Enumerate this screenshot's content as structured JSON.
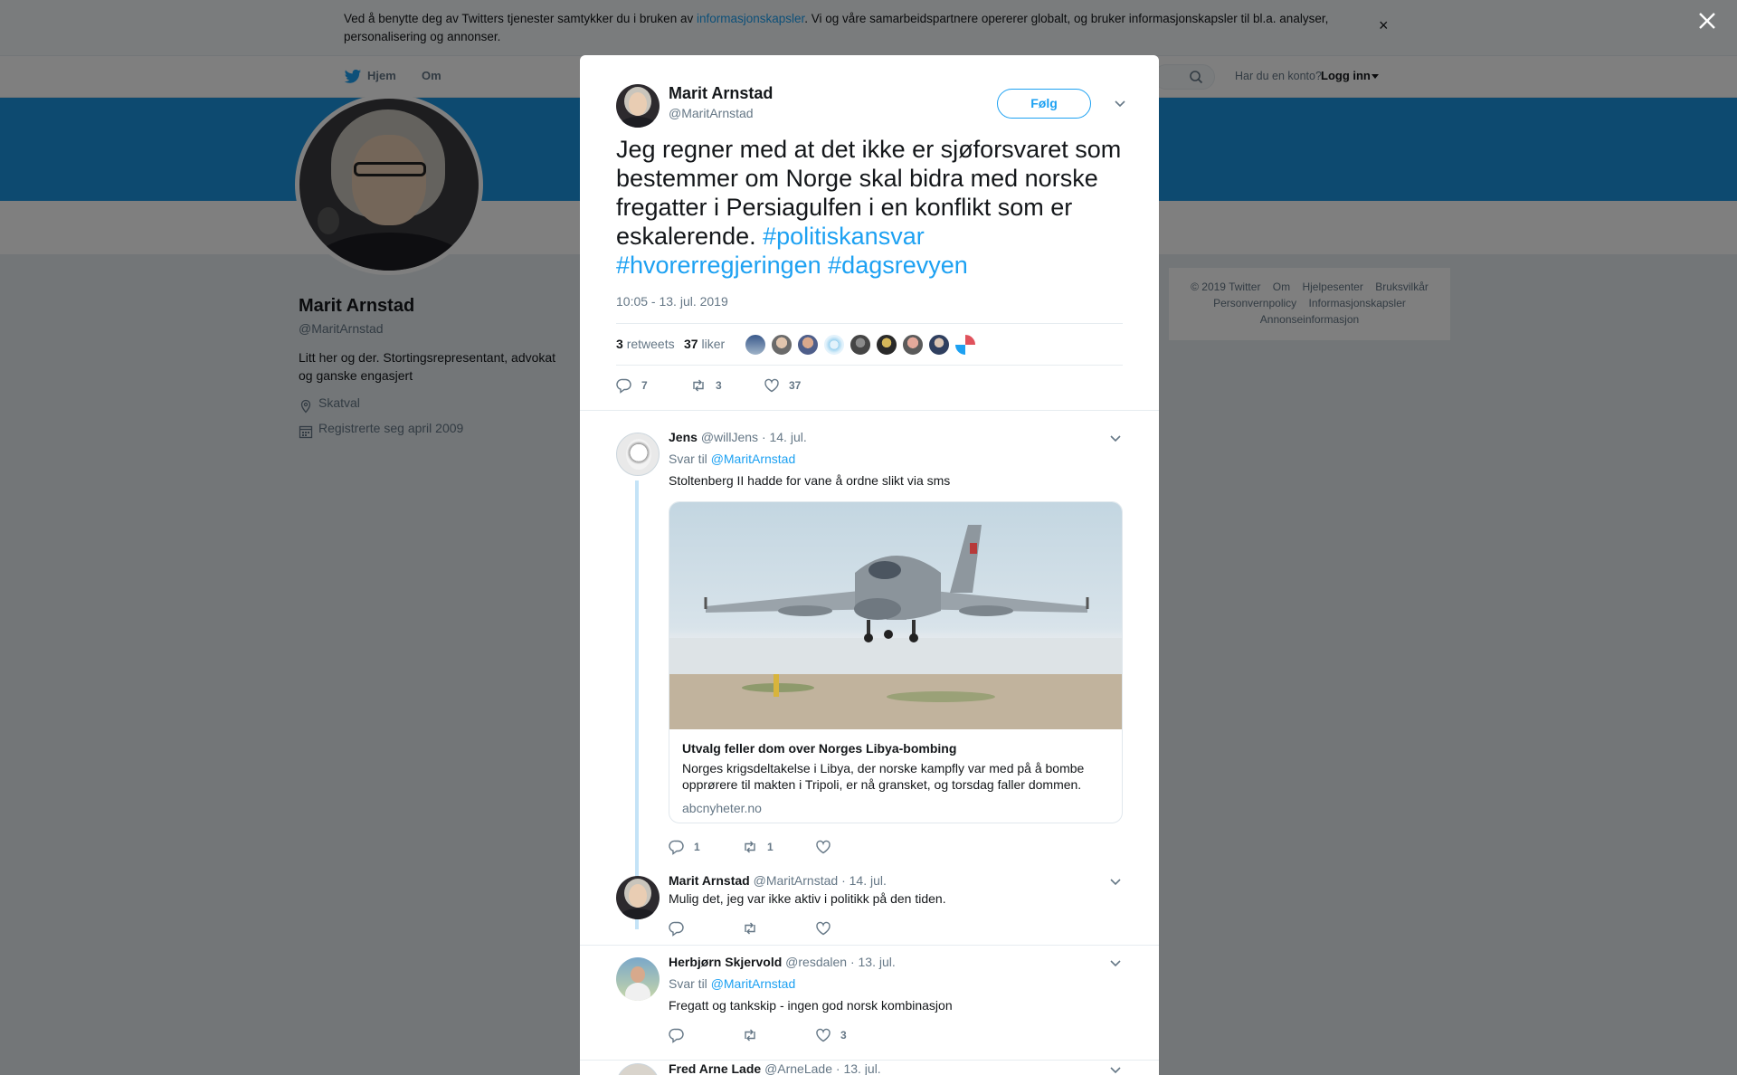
{
  "cookie_bar": {
    "text_before": "Ved å benytte deg av Twitters tjenester samtykker du i bruken av ",
    "link": "informasjonskapsler",
    "text_after": ". Vi og våre samarbeidspartnere opererer globalt, og bruker informasjonskapsler til bl.a. analyser, personalisering og annonser.",
    "close": "×"
  },
  "nav": {
    "home": "Hjem",
    "about": "Om",
    "account_prompt": "Har du en konto?",
    "login": "Logg inn"
  },
  "profile": {
    "name": "Marit Arnstad",
    "handle": "@MaritArnstad",
    "bio": "Litt her og der. Stortingsrepresentant, advokat og ganske engasjert",
    "location": "Skatval",
    "joined": "Registrerte seg april 2009"
  },
  "footer_links": [
    "© 2019 Twitter",
    "Om",
    "Hjelpesenter",
    "Bruksvilkår",
    "Personvernpolicy",
    "Informasjonskapsler",
    "Annonseinformasjon"
  ],
  "tweet": {
    "name": "Marit Arnstad",
    "handle": "@MaritArnstad",
    "follow": "Følg",
    "text": "Jeg regner med at det ikke er sjøforsvaret som bestemmer om Norge skal bidra med norske fregatter i Persiagulfen i en konflikt som er eskalerende.",
    "hashtags": [
      "#politiskansvar",
      "#hvorerregjeringen",
      "#dagsrevyen"
    ],
    "timestamp": "10:05 - 13. jul. 2019",
    "retweets_count": "3",
    "retweets_label": "retweets",
    "likes_count": "37",
    "likes_label": "liker",
    "actions": {
      "replies": "7",
      "retweets": "3",
      "likes": "37"
    }
  },
  "replies": [
    {
      "name": "Jens",
      "handle": "@willJens",
      "date": "· 14. jul.",
      "reply_to_label": "Svar til",
      "reply_to": "@MaritArnstad",
      "text": "Stoltenberg II hadde for vane å ordne slikt via sms",
      "card": {
        "title": "Utvalg feller dom over Norges Libya-bombing",
        "description": "Norges krigsdeltakelse i Libya, der norske kampfly var med på å bombe opprørere til makten i Tripoli, er nå gransket, og torsdag faller dommen.",
        "domain": "abcnyheter.no"
      },
      "actions": {
        "replies": "1",
        "retweets": "1",
        "likes": ""
      }
    },
    {
      "name": "Marit Arnstad",
      "handle": "@MaritArnstad",
      "date": "· 14. jul.",
      "text": "Mulig det, jeg var ikke aktiv i politikk på den tiden.",
      "actions": {
        "replies": "",
        "retweets": "",
        "likes": ""
      }
    },
    {
      "name": "Herbjørn Skjervold",
      "handle": "@resdalen",
      "date": "· 13. jul.",
      "reply_to_label": "Svar til",
      "reply_to": "@MaritArnstad",
      "text": "Fregatt og tankskip - ingen god norsk kombinasjon",
      "actions": {
        "replies": "",
        "retweets": "",
        "likes": "3"
      }
    },
    {
      "name": "Fred Arne Lade",
      "handle": "@ArneLade",
      "date": "· 13. jul."
    }
  ],
  "colors": {
    "accent": "#1da1f2",
    "banner": "#1b95e0",
    "thread_line": "#c4e3f7"
  },
  "icons": [
    "twitter-bird-icon",
    "search-icon",
    "location-icon",
    "calendar-icon",
    "reply-icon",
    "retweet-icon",
    "like-icon",
    "chevron-down-icon",
    "close-icon"
  ]
}
